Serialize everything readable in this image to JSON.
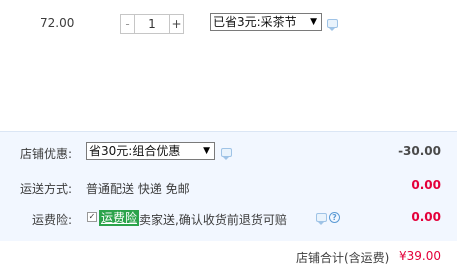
{
  "item": {
    "price": "72.00",
    "qty_minus": "-",
    "qty_value": "1",
    "qty_plus": "+",
    "promo_selected": "已省3元:采茶节"
  },
  "shop": {
    "discount_label": "店铺优惠:",
    "discount_selected": "省30元:组合优惠",
    "discount_amount": "-30.00",
    "shipping_label": "运送方式:",
    "shipping_text": "普通配送 快递 免邮",
    "shipping_amount": "0.00",
    "insurance_label": "运费险:",
    "insurance_checked": true,
    "insurance_tag": "运费险",
    "insurance_desc": "卖家送,确认收货前退货可赔",
    "insurance_amount": "0.00"
  },
  "total": {
    "label": "店铺合计(含运费)",
    "value": "¥39.00"
  },
  "icons": {
    "message": "message-icon",
    "help": "help-icon",
    "dropdown": "chevron-down-icon"
  },
  "colors": {
    "price_red": "#e4003a",
    "summary_bg": "#f2f7ff",
    "insurance_green": "#2ba34b"
  }
}
